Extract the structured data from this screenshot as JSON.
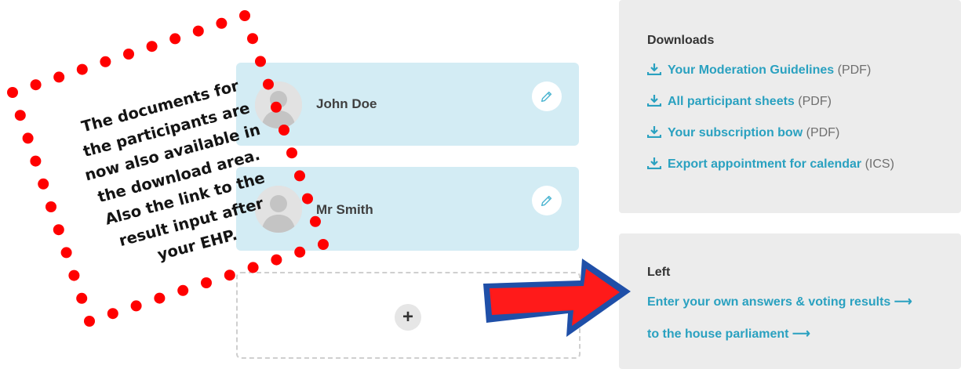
{
  "participants": [
    {
      "name": "John Doe"
    },
    {
      "name": "Mr Smith"
    }
  ],
  "add_button": {
    "label": "+"
  },
  "downloads": {
    "heading": "Downloads",
    "items": [
      {
        "label": "Your Moderation Guidelines",
        "type": "(PDF)"
      },
      {
        "label": "All participant sheets",
        "type": "(PDF)"
      },
      {
        "label": "Your subscription bow",
        "type": "(PDF)"
      },
      {
        "label": "Export appointment for calendar",
        "type": "(ICS)"
      }
    ]
  },
  "left": {
    "heading": "Left",
    "links": [
      {
        "label": "Enter your own answers & voting results ⟶"
      },
      {
        "label": "to the house parliament ⟶"
      }
    ]
  },
  "annotation": {
    "lines": [
      "The documents for",
      "the participants are",
      "now also available in",
      "the download area.",
      "Also the link to the",
      "result input after",
      "your EHP."
    ]
  },
  "colors": {
    "card_bg": "#d3ecf4",
    "panel_bg": "#ececec",
    "link": "#2aa1c0",
    "dots": "#ff0000",
    "arrow_fill": "#ff1a1a",
    "arrow_outline": "#1f4fa8"
  },
  "icons": {
    "avatar": "avatar-icon",
    "edit": "pencil-icon",
    "download": "download-icon",
    "add": "plus-icon"
  }
}
